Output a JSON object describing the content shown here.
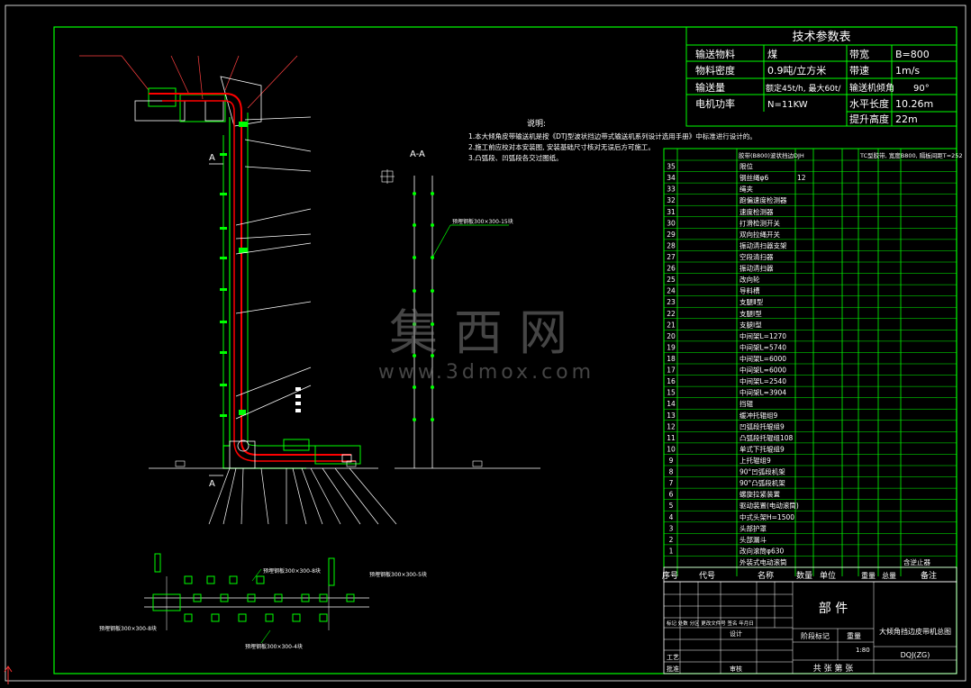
{
  "colors": {
    "background": "#000000",
    "frame": "#00ff00",
    "conveyor": "#ff0000",
    "structure": "#00ff00",
    "text": "#ffffff",
    "dim_line": "#ffffff",
    "watermark": "#808080"
  },
  "params_table": {
    "title": "技术参数表",
    "rows": [
      {
        "k1": "输送物料",
        "v1": "煤",
        "k2": "带宽",
        "v2": "B=800"
      },
      {
        "k1": "物料密度",
        "v1": "0.9吨/立方米",
        "k2": "带速",
        "v2": "1m/s"
      },
      {
        "k1": "输送量",
        "v1": "额定45t/h, 最大60t/",
        "k2": "输送机倾角",
        "v2": "90°"
      },
      {
        "k1": "电机功率",
        "v1": "N=11KW",
        "k2": "水平长度",
        "v2": "10.26m"
      },
      {
        "k1": "",
        "v1": "",
        "k2": "提升高度",
        "v2": "22m"
      }
    ]
  },
  "notes": {
    "title": "说明:",
    "lines": [
      "1.本大倾角皮带输送机是按《DTJ型波状挡边带式输送机系列设计选用手册》中标准进行设计的。",
      "2.施工前应校对本安装图, 安装基础尺寸核对无误后方可施工。",
      "3.凸弧段、凹弧段各交过图纸。"
    ]
  },
  "section_label": "A-A",
  "section_mark": "A",
  "bom": {
    "header": {
      "seq": "序号",
      "code": "代号",
      "name": "名称",
      "qty": "数量",
      "unit": "单位",
      "weight": "重量",
      "total": "总量",
      "remark": "备注"
    },
    "top_row_name": "胶带(B800)波状挡边DJH",
    "top_row_remark": "TC型胶带, 宽度B800, 隔板间距T=252",
    "items": [
      {
        "no": "35",
        "name": "限位"
      },
      {
        "no": "34",
        "name": "钢丝绳φ6",
        "qty": "12"
      },
      {
        "no": "33",
        "name": "绳夹"
      },
      {
        "no": "32",
        "name": "跑偏速度检测器"
      },
      {
        "no": "31",
        "name": "速度检测器"
      },
      {
        "no": "30",
        "name": "打滑检测开关"
      },
      {
        "no": "29",
        "name": "双向拉绳开关"
      },
      {
        "no": "28",
        "name": "振动清扫器支架"
      },
      {
        "no": "27",
        "name": "空段清扫器"
      },
      {
        "no": "26",
        "name": "振动清扫器"
      },
      {
        "no": "25",
        "name": "改向轮"
      },
      {
        "no": "24",
        "name": "导料槽"
      },
      {
        "no": "23",
        "name": "支腿Ⅱ型"
      },
      {
        "no": "22",
        "name": "支腿Ⅰ型"
      },
      {
        "no": "21",
        "name": "支腿Ⅰ型"
      },
      {
        "no": "20",
        "name": "中间架L=1270"
      },
      {
        "no": "19",
        "name": "中间架L=5740"
      },
      {
        "no": "18",
        "name": "中间架L=6000"
      },
      {
        "no": "17",
        "name": "中间架L=6000"
      },
      {
        "no": "16",
        "name": "中间架L=2540"
      },
      {
        "no": "15",
        "name": "中间架L=3904"
      },
      {
        "no": "14",
        "name": "挡辊"
      },
      {
        "no": "13",
        "name": "缓冲托辊组9"
      },
      {
        "no": "12",
        "name": "凹弧段托辊组9"
      },
      {
        "no": "11",
        "name": "凸弧段托辊组108"
      },
      {
        "no": "10",
        "name": "单式下托辊组9"
      },
      {
        "no": "9",
        "name": "上托辊组9"
      },
      {
        "no": "8",
        "name": "90°凹弧段机架"
      },
      {
        "no": "7",
        "name": "90°凸弧段机架"
      },
      {
        "no": "6",
        "name": "螺旋拉紧装置"
      },
      {
        "no": "5",
        "name": "驱动装置(电动滚筒)"
      },
      {
        "no": "4",
        "name": "中式头架H=1500"
      },
      {
        "no": "3",
        "name": "头部护罩"
      },
      {
        "no": "2",
        "name": "头部漏斗"
      },
      {
        "no": "1",
        "name": "改向滚筒φ630"
      },
      {
        "no": "",
        "name": "外装式电动滚筒",
        "remark": "含逆止器"
      }
    ]
  },
  "title_block": {
    "part": "部    件",
    "project": "大倾角挡边皮带机总图",
    "drawing_no": "DQJ(ZG)",
    "stage": "阶段标记",
    "weight": "重量",
    "scale": "比例",
    "scale_value": "1:80",
    "sheets": "共   张  第   张",
    "designer": "设计",
    "checker": "审核",
    "process": "工艺",
    "standard": "标准化",
    "approve": "批准",
    "change": "标记 处数 分区 更改文件号 签名 年月日"
  },
  "callouts_plan": [
    "预埋钢板300×300-8块",
    "预埋钢板300×300-8块",
    "预埋钢板300×300-5块",
    "预埋钢板300×300-4块"
  ],
  "callout_section": "预埋钢板300×300-15块",
  "watermark": {
    "cn": "集西网",
    "url": "www.3dmox.com"
  }
}
